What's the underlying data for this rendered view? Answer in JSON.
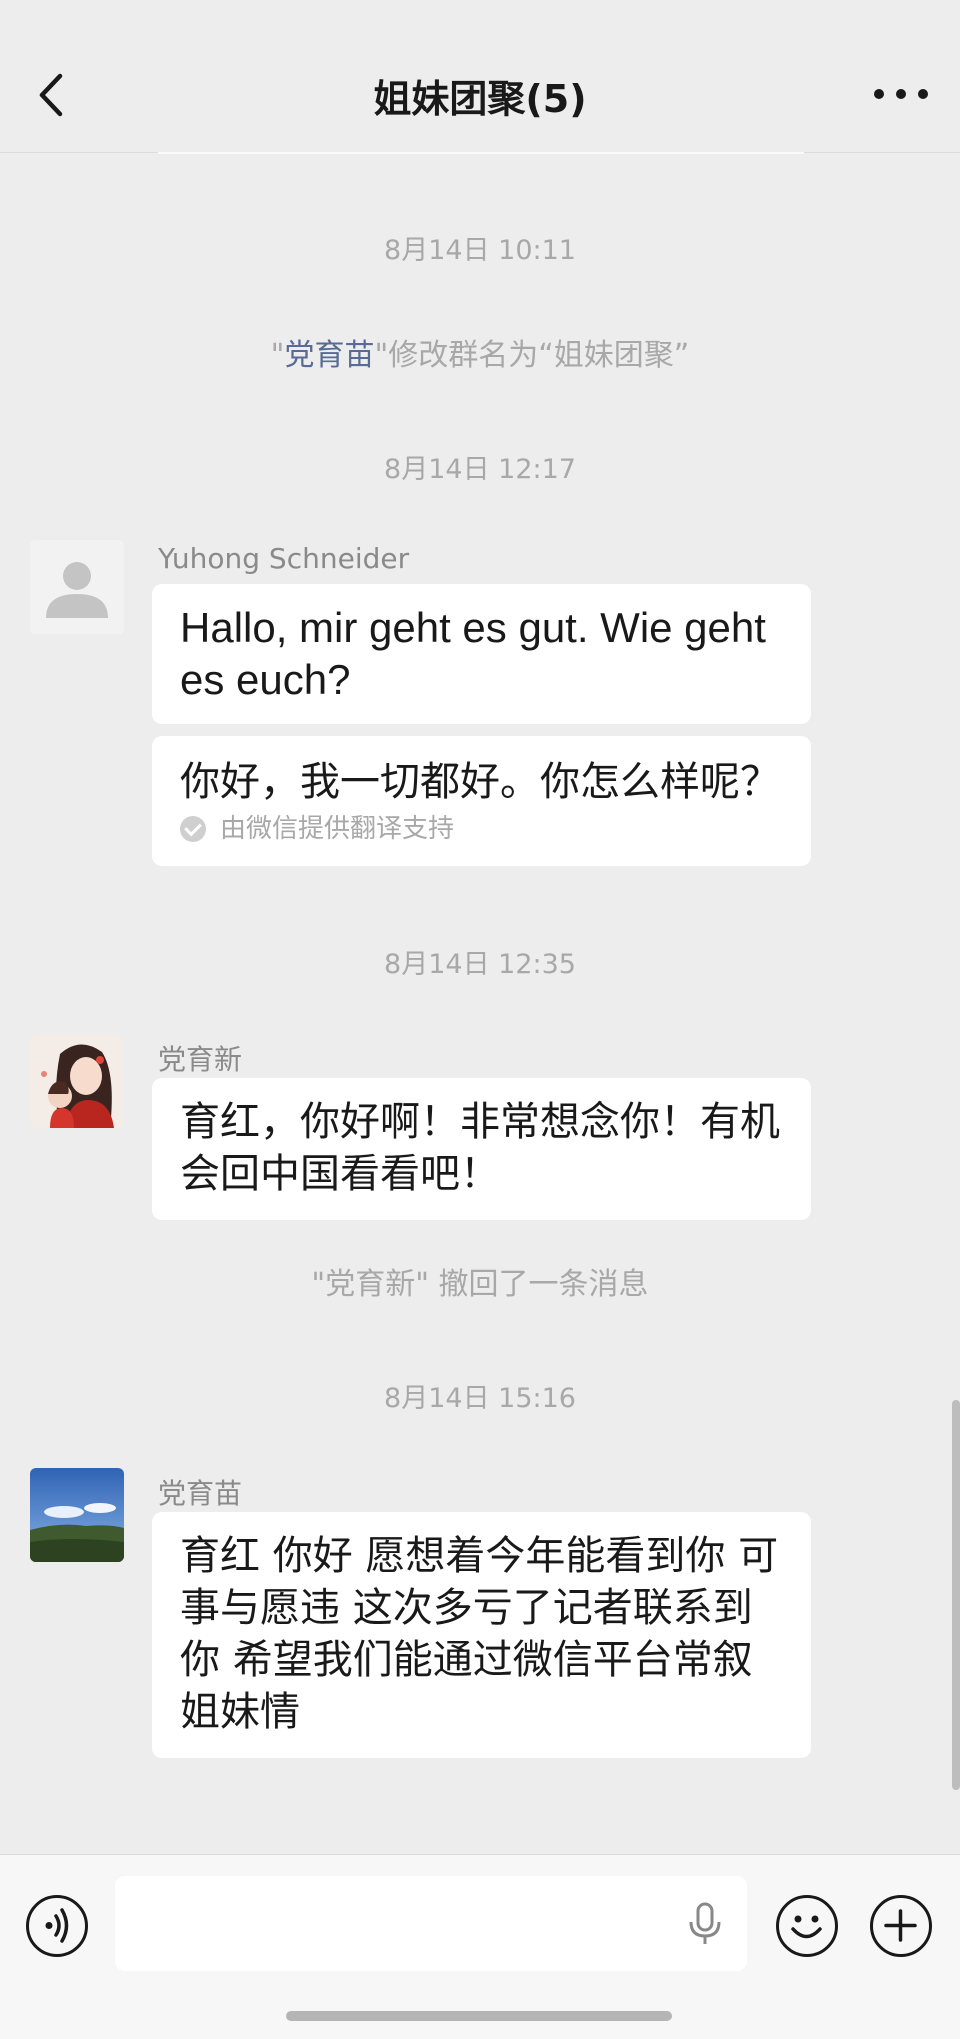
{
  "header": {
    "back_icon": "chevron-left-icon",
    "title": "姐妹团聚(5)",
    "more_icon": "ellipsis-icon"
  },
  "timeline": {
    "time1": "8月14日 10:11",
    "rename_notice": {
      "quote_open": "\"",
      "actor": "党育苗",
      "text": "\"修改群名为“姐妹团聚”"
    },
    "time2": "8月14日 12:17",
    "time3": "8月14日 12:35",
    "recall_notice": "\"党育新\" 撤回了一条消息",
    "time4": "8月14日 15:16"
  },
  "messages": [
    {
      "sender": "Yuhong Schneider",
      "text": "Hallo, mir geht es gut. Wie geht es euch?",
      "translation": "你好，我一切都好。你怎么样呢？",
      "translation_note": "由微信提供翻译支持"
    },
    {
      "sender": "党育新",
      "text": "育红，你好啊！非常想念你！有机会回中国看看吧！"
    },
    {
      "sender": "党育苗",
      "text": "育红 你好 愿想着今年能看到你 可事与愿违 这次多亏了记者联系到你 希望我们能通过微信平台常叙姐妹情"
    }
  ],
  "input_bar": {
    "voice_icon": "voice-mode-icon",
    "mic_icon": "microphone-icon",
    "emoji_icon": "emoji-icon",
    "plus_icon": "plus-icon"
  },
  "colors": {
    "background": "#ededed",
    "bubble": "#ffffff",
    "link": "#576b95",
    "muted": "#a8a8a8"
  }
}
